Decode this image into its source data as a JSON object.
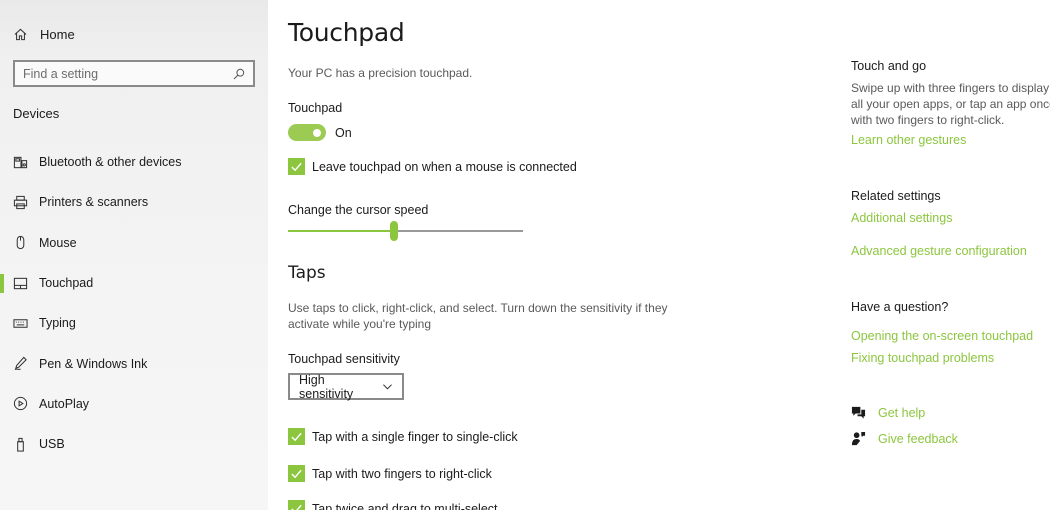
{
  "sidebar": {
    "home_label": "Home",
    "search_placeholder": "Find a setting",
    "section_title": "Devices",
    "items": [
      {
        "label": "Bluetooth & other devices",
        "icon": "bluetooth-devices-icon"
      },
      {
        "label": "Printers & scanners",
        "icon": "printer-icon"
      },
      {
        "label": "Mouse",
        "icon": "mouse-icon"
      },
      {
        "label": "Touchpad",
        "icon": "touchpad-icon",
        "active": true
      },
      {
        "label": "Typing",
        "icon": "keyboard-icon"
      },
      {
        "label": "Pen & Windows Ink",
        "icon": "pen-icon"
      },
      {
        "label": "AutoPlay",
        "icon": "autoplay-icon"
      },
      {
        "label": "USB",
        "icon": "usb-icon"
      }
    ]
  },
  "main": {
    "title": "Touchpad",
    "precision_text": "Your PC has a precision touchpad.",
    "touchpad_label": "Touchpad",
    "toggle_state": "On",
    "leave_on_label": "Leave touchpad on when a mouse is connected",
    "cursor_speed_label": "Change the cursor speed",
    "cursor_speed_fraction": 0.45,
    "taps_heading": "Taps",
    "taps_desc": "Use taps to click, right-click, and select. Turn down the sensitivity if they activate while you're typing",
    "sensitivity_label": "Touchpad sensitivity",
    "sensitivity_value": "High sensitivity",
    "tap_single_label": "Tap with a single finger to single-click",
    "tap_two_label": "Tap with two fingers to right-click",
    "tap_twice_label": "Tap twice and drag to multi-select"
  },
  "right": {
    "touch_heading": "Touch and go",
    "touch_text_1": "Swipe up with three fingers to display",
    "touch_text_2": "all your open apps, or tap an app once",
    "touch_text_3": "with two fingers to right-click.",
    "learn_link": "Learn other gestures",
    "related_heading": "Related settings",
    "additional_link": "Additional settings",
    "advanced_link": "Advanced gesture configuration",
    "question_heading": "Have a question?",
    "opening_link": "Opening the on-screen touchpad",
    "fixing_link": "Fixing touchpad problems",
    "get_help": "Get help",
    "give_feedback": "Give feedback"
  },
  "colors": {
    "accent": "#8cc63f",
    "sidebar_bg": "#f2f2f2"
  }
}
